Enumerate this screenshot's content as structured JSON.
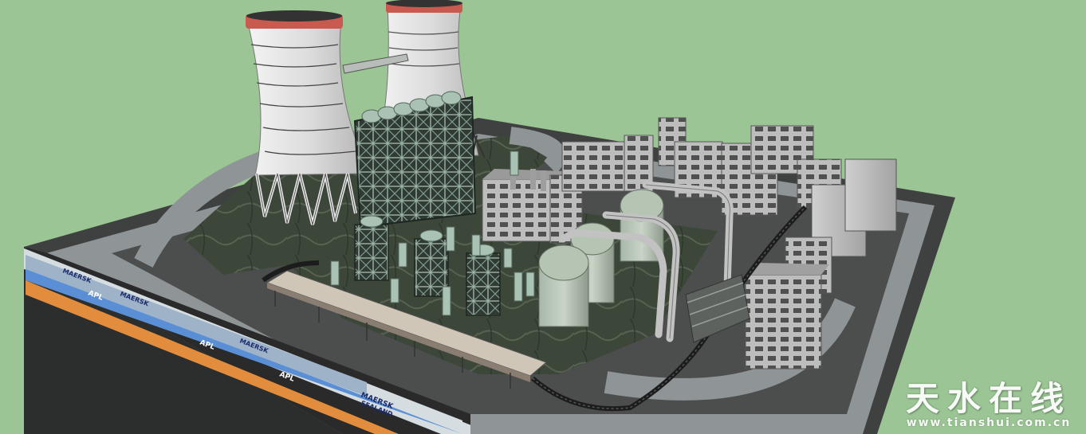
{
  "scene": {
    "background_color": "#9bc594",
    "base_color": "#4a4c4a",
    "road_color": "#8f9496",
    "ground_color": "#3d4a3a",
    "tower_body_color": "#e6e6e6",
    "tower_rim_color": "#c85a50"
  },
  "containers": {
    "label_maersk": "MAERSK",
    "label_sealand": "SEALAND",
    "label_apl": "APL",
    "colors": [
      "#5a8fd6",
      "#e28d3e",
      "#d6dde0",
      "#2e4fa8",
      "#c9b06a"
    ]
  },
  "watermark": {
    "chinese": "天水在线",
    "url": "www.tianshui.com.cn"
  }
}
